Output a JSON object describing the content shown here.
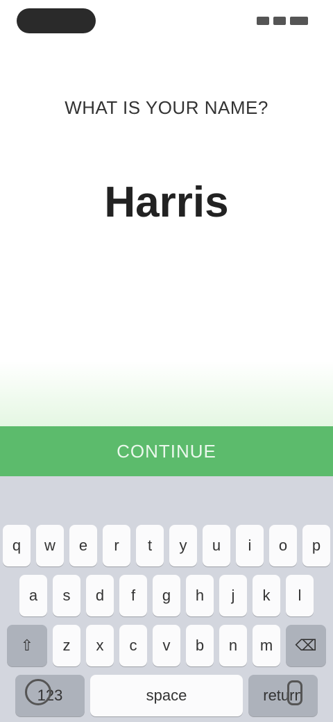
{
  "prompt_text": "WHAT IS YOUR NAME?",
  "name_value": "Harris",
  "cta_label": "CONTINUE",
  "keyboard": {
    "suggestions": [
      "",
      "",
      ""
    ],
    "row1": [
      "q",
      "w",
      "e",
      "r",
      "t",
      "y",
      "u",
      "i",
      "o",
      "p"
    ],
    "row2": [
      "a",
      "s",
      "d",
      "f",
      "g",
      "h",
      "j",
      "k",
      "l"
    ],
    "row3": [
      "z",
      "x",
      "c",
      "v",
      "b",
      "n",
      "m"
    ],
    "space_label": "space",
    "return_label": "return"
  }
}
